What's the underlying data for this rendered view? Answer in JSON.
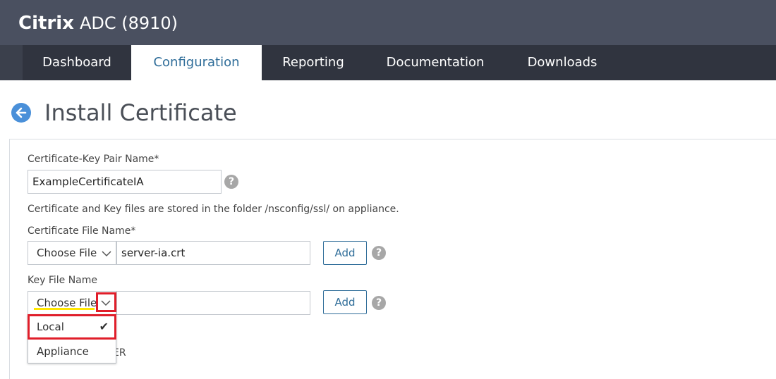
{
  "app": {
    "brand": "Citrix",
    "product": "ADC (8910)"
  },
  "nav": {
    "tabs": [
      {
        "label": "Dashboard"
      },
      {
        "label": "Configuration"
      },
      {
        "label": "Reporting"
      },
      {
        "label": "Documentation"
      },
      {
        "label": "Downloads"
      }
    ],
    "active": "Configuration"
  },
  "page": {
    "title": "Install Certificate"
  },
  "form": {
    "cert_key_pair": {
      "label": "Certificate-Key Pair Name*",
      "value": "ExampleCertificateIA"
    },
    "info_text": "Certificate and Key files are stored in the folder /nsconfig/ssl/ on appliance.",
    "cert_file": {
      "label": "Certificate File Name*",
      "choose_label": "Choose File",
      "value": "server-ia.crt",
      "add_label": "Add"
    },
    "key_file": {
      "label": "Key File Name",
      "choose_label": "Choose File",
      "value": "",
      "add_label": "Add"
    },
    "help_glyph": "?",
    "hidden_text_fragment": "ER"
  },
  "dropdown": {
    "options": [
      {
        "label": "Local",
        "selected": true
      },
      {
        "label": "Appliance",
        "selected": false
      }
    ],
    "check_glyph": "✔"
  },
  "colors": {
    "accent": "#2f6d99",
    "highlight": "#e01e2a",
    "underline": "#ffe600"
  }
}
